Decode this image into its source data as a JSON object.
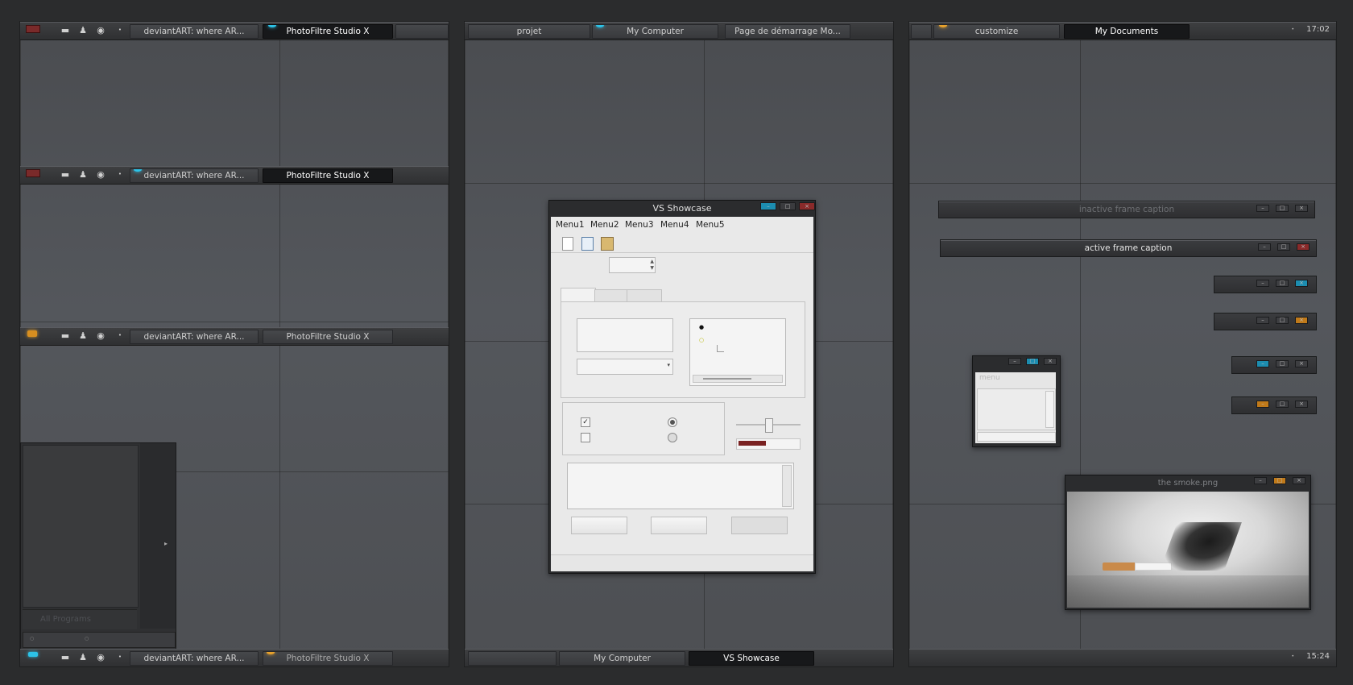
{
  "left": {
    "taskbars": [
      {
        "tab1": "deviantART: where AR...",
        "tab2": "PhotoFiltre Studio X"
      },
      {
        "tab1": "deviantART: where AR...",
        "tab2": "PhotoFiltre Studio X"
      },
      {
        "tab1": "deviantART: where AR...",
        "tab2": "PhotoFiltre Studio X"
      },
      {
        "tab1": "deviantART: where AR...",
        "tab2": "PhotoFiltre Studio X"
      }
    ],
    "start_menu": {
      "all_programs": "All Programs"
    }
  },
  "middle": {
    "top_tabs": [
      "projet",
      "My Computer",
      "Page de démarrage Mo..."
    ],
    "bottom_tabs": [
      "My Computer",
      "VS Showcase"
    ],
    "window": {
      "title": "VS Showcase",
      "menus": [
        "Menu1",
        "Menu2",
        "Menu3",
        "Menu4",
        "Menu5"
      ]
    }
  },
  "right": {
    "top_tabs": [
      "customize",
      "My Documents"
    ],
    "clock_top": "17:02",
    "clock_bottom": "15:24",
    "inactive_caption": "inactive frame caption",
    "active_caption": "active frame caption",
    "mini_menu": "menu",
    "image_title": "the smoke.png"
  },
  "colors": {
    "accent_cyan": "#2cc3e8",
    "accent_orange": "#e8a22c",
    "close_red": "#8a2a2a"
  }
}
